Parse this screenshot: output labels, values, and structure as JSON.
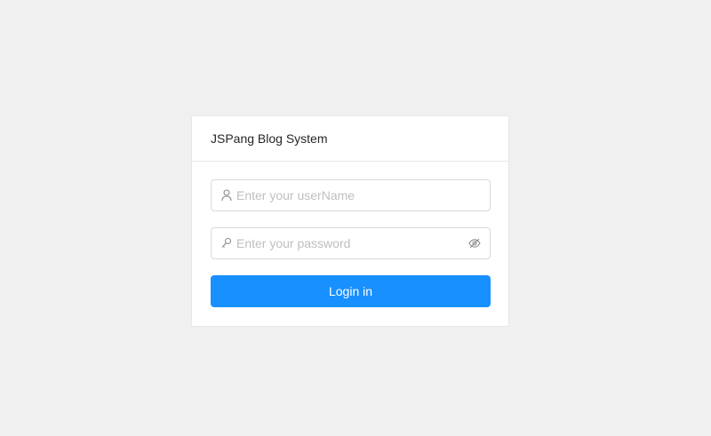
{
  "card": {
    "title": "JSPang Blog System"
  },
  "username": {
    "placeholder": "Enter your userName",
    "value": "",
    "icon": "user-icon"
  },
  "password": {
    "placeholder": "Enter your password",
    "value": "",
    "icon": "key-icon",
    "toggle_icon": "eye-invisible-icon"
  },
  "login_button": {
    "label": "Login in"
  },
  "colors": {
    "background": "#f0f0f0",
    "primary": "#1890ff",
    "border": "#d9d9d9",
    "placeholder": "#bfbfbf"
  }
}
